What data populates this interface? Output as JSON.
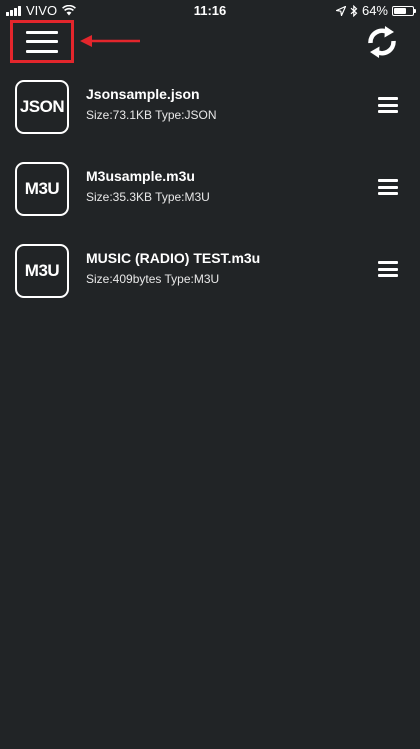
{
  "status_bar": {
    "carrier": "VIVO",
    "time": "11:16",
    "battery": "64%",
    "battery_level": 0.64,
    "icons": [
      "signal-icon",
      "wifi-icon",
      "location-arrow-icon",
      "bluetooth-icon",
      "battery-icon"
    ]
  },
  "header": {
    "menu_icon": "hamburger-menu-icon",
    "refresh_icon": "sync-icon",
    "annotation_color": "#e3262c"
  },
  "files": [
    {
      "badge": "JSON",
      "name": "Jsonsample.json",
      "meta": "Size:73.1KB Type:JSON"
    },
    {
      "badge": "M3U",
      "name": "M3usample.m3u",
      "meta": "Size:35.3KB Type:M3U"
    },
    {
      "badge": "M3U",
      "name": "MUSIC (RADIO) TEST.m3u",
      "meta": "Size:409bytes Type:M3U"
    }
  ],
  "colors": {
    "background": "#212426",
    "text": "#ffffff",
    "highlight": "#e3262c"
  }
}
